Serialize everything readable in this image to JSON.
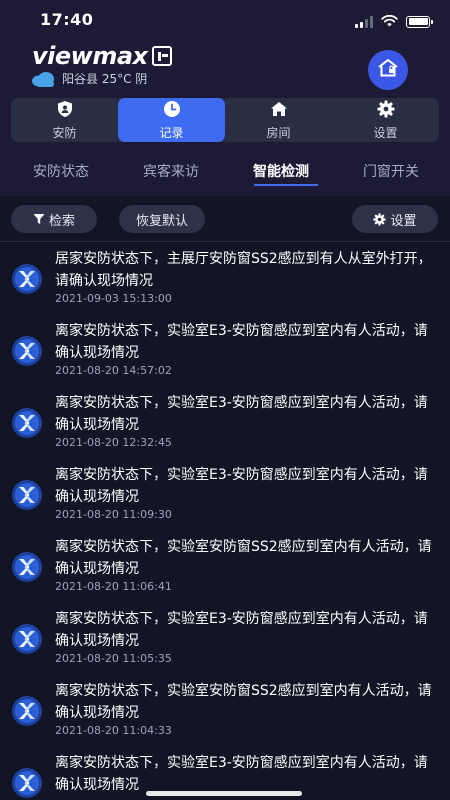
{
  "status_bar": {
    "time": "17:40"
  },
  "brand": {
    "logo": "viewmax",
    "weather": "阳谷县 25°C 阴"
  },
  "colors": {
    "accent": "#3d6cf2",
    "header_bg": "#1c1a35",
    "page_bg": "#121526"
  },
  "nav": {
    "items": [
      {
        "label": "安防",
        "icon": "shield-icon"
      },
      {
        "label": "记录",
        "icon": "clock-icon",
        "active": true
      },
      {
        "label": "房间",
        "icon": "house-icon"
      },
      {
        "label": "设置",
        "icon": "gear-icon"
      }
    ]
  },
  "subtabs": {
    "items": [
      {
        "label": "安防状态"
      },
      {
        "label": "宾客来访"
      },
      {
        "label": "智能检测",
        "active": true
      },
      {
        "label": "门窗开关"
      }
    ]
  },
  "toolbar": {
    "search_label": "检索",
    "reset_label": "恢复默认",
    "settings_label": "设置"
  },
  "records": [
    {
      "text": "居家安防状态下，主展厅安防窗SS2感应到有人从室外打开，请确认现场情况",
      "time": "2021-09-03 15:13:00"
    },
    {
      "text": "离家安防状态下，实验室E3-安防窗感应到室内有人活动，请确认现场情况",
      "time": "2021-08-20 14:57:02"
    },
    {
      "text": "离家安防状态下，实验室E3-安防窗感应到室内有人活动，请确认现场情况",
      "time": "2021-08-20 12:32:45"
    },
    {
      "text": "离家安防状态下，实验室E3-安防窗感应到室内有人活动，请确认现场情况",
      "time": "2021-08-20 11:09:30"
    },
    {
      "text": "离家安防状态下，实验室安防窗SS2感应到室内有人活动，请确认现场情况",
      "time": "2021-08-20 11:06:41"
    },
    {
      "text": "离家安防状态下，实验室E3-安防窗感应到室内有人活动，请确认现场情况",
      "time": "2021-08-20 11:05:35"
    },
    {
      "text": "离家安防状态下，实验室安防窗SS2感应到室内有人活动，请确认现场情况",
      "time": "2021-08-20 11:04:33"
    },
    {
      "text": "离家安防状态下，实验室E3-安防窗感应到室内有人活动，请确认现场情况",
      "time": ""
    }
  ]
}
